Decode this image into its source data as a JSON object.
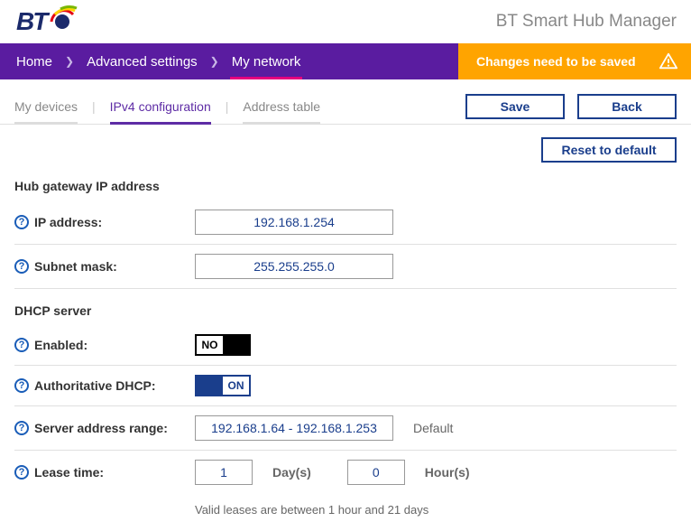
{
  "header": {
    "app_title": "BT Smart Hub Manager",
    "logo_text": "BT"
  },
  "breadcrumb": {
    "home": "Home",
    "advanced": "Advanced settings",
    "mynetwork": "My network"
  },
  "alert": {
    "text": "Changes need to be saved"
  },
  "tabs": {
    "devices": "My devices",
    "ipv4": "IPv4 configuration",
    "address": "Address table"
  },
  "buttons": {
    "save": "Save",
    "back": "Back",
    "reset": "Reset to default"
  },
  "section1": {
    "title": "Hub gateway IP address"
  },
  "ip": {
    "label": "IP address:",
    "value": "192.168.1.254"
  },
  "subnet": {
    "label": "Subnet mask:",
    "value": "255.255.255.0"
  },
  "section2": {
    "title": "DHCP server"
  },
  "enabled": {
    "label": "Enabled:",
    "value": "NO"
  },
  "auth": {
    "label": "Authoritative DHCP:",
    "value": "ON"
  },
  "range": {
    "label": "Server address range:",
    "value": "192.168.1.64 - 192.168.1.253",
    "suffix": "Default"
  },
  "lease": {
    "label": "Lease time:",
    "days": "1",
    "days_label": "Day(s)",
    "hours": "0",
    "hours_label": "Hour(s)"
  },
  "note": "Valid leases are between 1 hour and 21 days"
}
